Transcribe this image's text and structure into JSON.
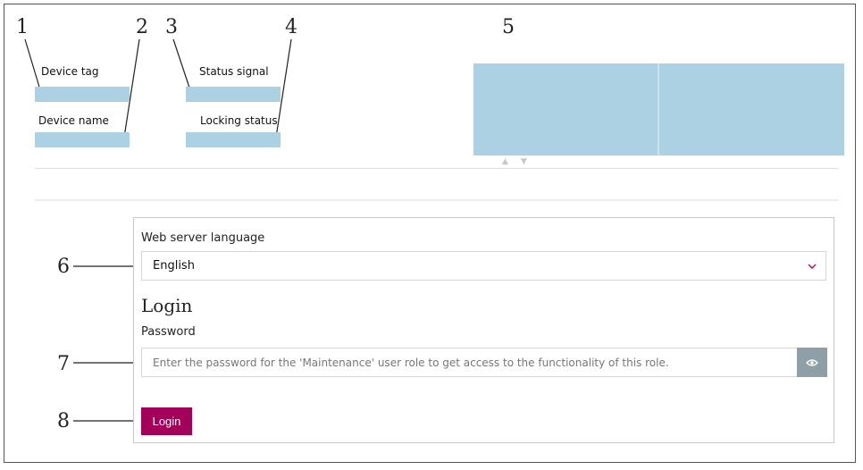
{
  "callouts": [
    "1",
    "2",
    "3",
    "4",
    "5",
    "6",
    "7",
    "8"
  ],
  "header": {
    "device_tag_label": "Device tag",
    "device_name_label": "Device name",
    "status_signal_label": "Status signal",
    "locking_status_label": "Locking status"
  },
  "login_panel": {
    "language_label": "Web server language",
    "language_value": "English",
    "login_title": "Login",
    "password_label": "Password",
    "password_placeholder": "Enter the password for the 'Maintenance' user role to get access to the functionality of this role.",
    "login_button": "Login"
  },
  "colors": {
    "field_blue": "#acd1e3",
    "brand_magenta": "#a3005a",
    "eye_button_gray": "#8e9fa7"
  },
  "icons": {
    "eye": "eye-icon",
    "chevron": "chevron-down-icon",
    "slider_arrows": "triangle-arrows-icon"
  }
}
